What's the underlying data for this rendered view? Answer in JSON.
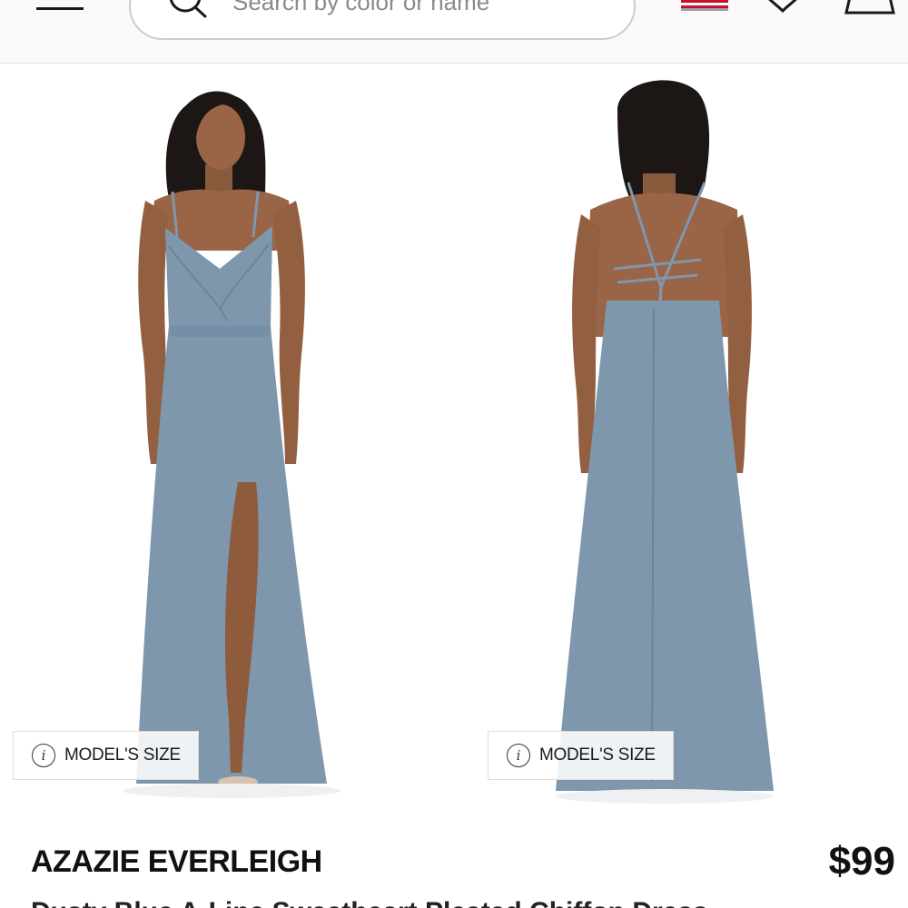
{
  "header": {
    "search_placeholder": "Search by color or name",
    "icons": [
      "menu-icon",
      "search-icon",
      "us-flag-icon",
      "wishlist-icon",
      "shopping-bag-icon"
    ]
  },
  "gallery": {
    "front_image": {
      "badge_label": "MODEL'S SIZE"
    },
    "back_image": {
      "badge_label": "MODEL'S SIZE"
    },
    "dress_color": "#7f97ad",
    "background_color": "#ffffff"
  },
  "product": {
    "name": "AZAZIE EVERLEIGH",
    "price": "$99",
    "subtitle": "Dusty Blue A-Line Sweetheart Pleated Chiffon Dress"
  }
}
